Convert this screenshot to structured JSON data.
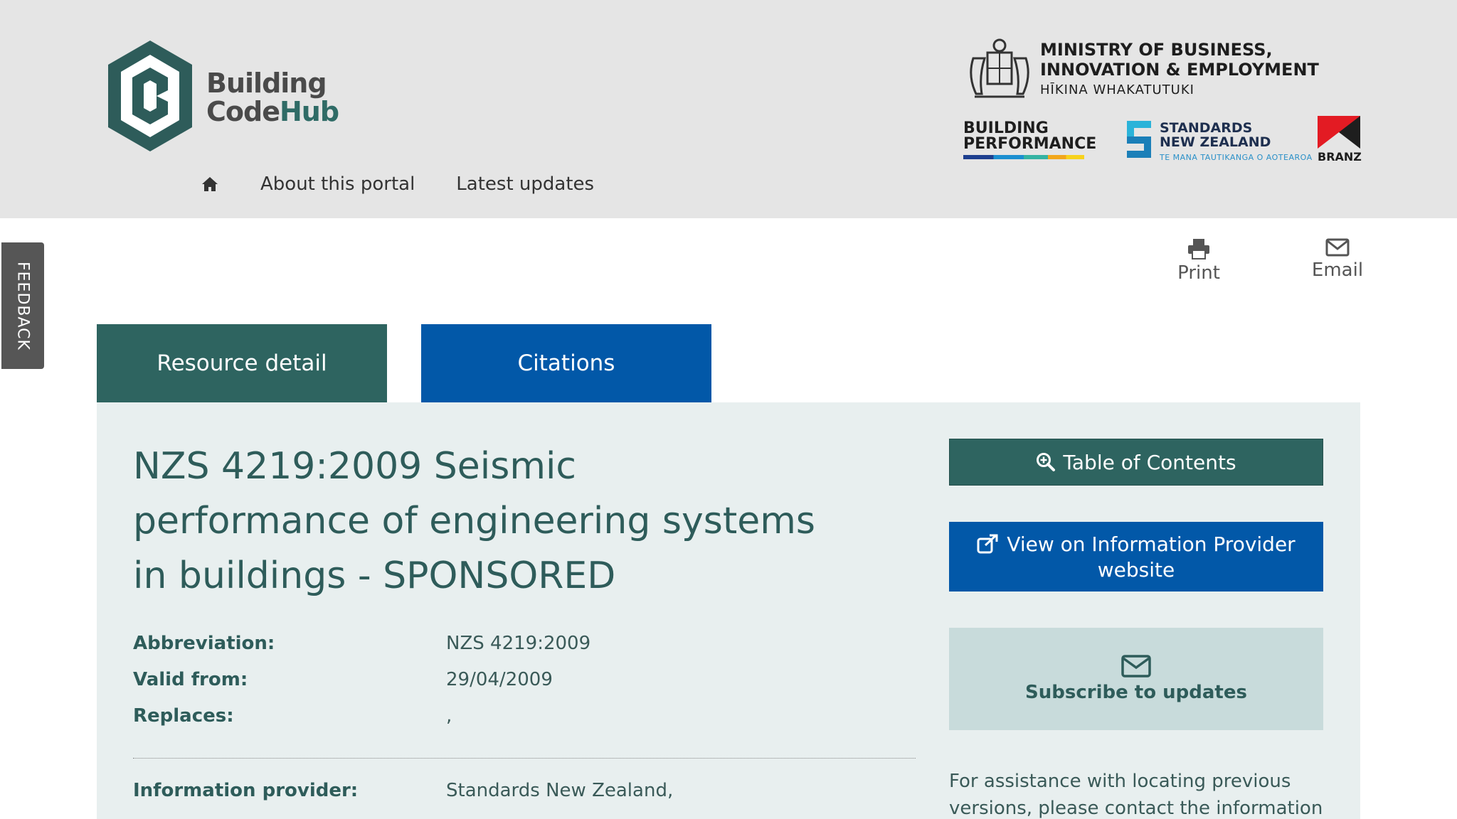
{
  "header": {
    "logo": {
      "line1": "Building",
      "line2a": "Code",
      "line2b": "Hub"
    },
    "nav": {
      "home_icon": "home-icon",
      "items": [
        "About this portal",
        "Latest updates"
      ]
    },
    "mbie": {
      "line1": "MINISTRY OF BUSINESS,",
      "line2": "INNOVATION & EMPLOYMENT",
      "line3": "HĪKINA WHAKATUTUKI"
    },
    "building_performance": {
      "line1": "BUILDING",
      "line2": "PERFORMANCE"
    },
    "standards_nz": {
      "line1": "STANDARDS",
      "line2": "NEW ZEALAND",
      "line3": "TE MANA TAUTIKANGA O AOTEAROA"
    },
    "branz": "BRANZ"
  },
  "feedback": "FEEDBACK",
  "tools": {
    "print": "Print",
    "email": "Email"
  },
  "tabs": {
    "detail": "Resource detail",
    "citations": "Citations"
  },
  "resource": {
    "title": "NZS 4219:2009 Seismic performance of engineering systems in buildings - SPONSORED",
    "fields": [
      {
        "label": "Abbreviation:",
        "value": "NZS 4219:2009"
      },
      {
        "label": "Valid from:",
        "value": "29/04/2009"
      },
      {
        "label": "Replaces:",
        "value": ","
      },
      {
        "label": "Information provider:",
        "value": "Standards New Zealand,"
      }
    ]
  },
  "sidebar": {
    "toc": "Table of Contents",
    "view": "View on Information Provider website",
    "subscribe": "Subscribe to updates",
    "assist": "For assistance with locating previous versions, please contact the information"
  },
  "colors": {
    "teal": "#2e6460",
    "blue": "#0258a8",
    "panel": "#e8efef"
  }
}
